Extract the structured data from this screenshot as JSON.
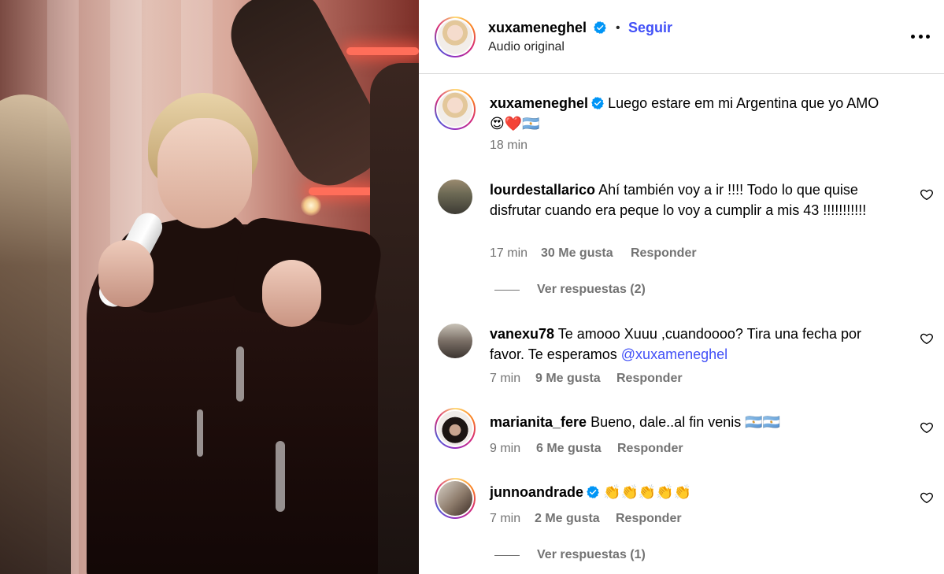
{
  "post": {
    "username": "xuxameneghel",
    "follow_label": "Seguir",
    "separator": "•",
    "audio_label": "Audio original",
    "caption_text": "Luego estare em mi Argentina que yo AMO",
    "caption_emojis": "😍❤️🇦🇷",
    "caption_time": "18 min"
  },
  "comments": [
    {
      "username": "lourdestallarico",
      "text": "Ahí también voy a ir !!!! Todo lo que quise disfrutar cuando era peque lo voy a cumplir a mis 43 !!!!!!!!!!!",
      "time": "17 min",
      "likes": "30 Me gusta",
      "reply_label": "Responder",
      "view_replies": "Ver respuestas (2)"
    },
    {
      "username": "vanexu78",
      "text": "Te amooo Xuuu ,cuandoooo? Tira una fecha por favor. Te esperamos",
      "mention": "@xuxameneghel",
      "time": "7 min",
      "likes": "9 Me gusta",
      "reply_label": "Responder"
    },
    {
      "username": "marianita_fere",
      "text": "Bueno, dale..al fin venis",
      "emojis": "🇦🇷🇦🇷",
      "time": "9 min",
      "likes": "6 Me gusta",
      "reply_label": "Responder"
    },
    {
      "username": "junnoandrade",
      "emojis": "👏👏👏👏👏",
      "time": "7 min",
      "likes": "2 Me gusta",
      "reply_label": "Responder",
      "view_replies": "Ver respuestas (1)"
    }
  ],
  "colors": {
    "link_blue": "#4150f7",
    "verified_blue": "#0095f6",
    "meta_gray": "#737373"
  },
  "icons": {
    "verified": "verified-badge-icon",
    "heart": "heart-outline-icon",
    "more": "more-options-icon"
  }
}
